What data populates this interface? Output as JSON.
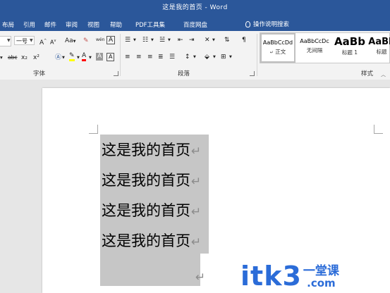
{
  "window": {
    "title": "这是我的首页 - Word"
  },
  "tabs": [
    "布局",
    "引用",
    "邮件",
    "审阅",
    "视图",
    "帮助",
    "PDF工具集",
    "百度网盘"
  ],
  "tell_me": "操作说明搜索",
  "ribbon": {
    "font": {
      "size_value": "一号",
      "grow": "A",
      "shrink": "A",
      "change_case": "Aa",
      "strikethrough": "abc",
      "subscript": "x₂",
      "superscript": "x²",
      "font_color": "A",
      "char_shading": "A",
      "phonetic": "wén",
      "group_label": "字体"
    },
    "paragraph": {
      "group_label": "段落"
    },
    "styles": {
      "group_label": "样式",
      "items": [
        {
          "sample": "AaBbCcDd",
          "name": "正文",
          "selected": true
        },
        {
          "sample": "AaBbCcDc",
          "name": "无间隔",
          "selected": false
        },
        {
          "sample": "AaBb",
          "name": "标题 1",
          "selected": false
        },
        {
          "sample": "AaBk",
          "name": "标题",
          "selected": false
        }
      ]
    }
  },
  "document": {
    "lines": [
      "这是我的首页",
      "这是我的首页",
      "这是我的首页",
      "这是我的首页"
    ],
    "paragraph_mark": "↵"
  },
  "watermark": {
    "main": "itk3",
    "cn": "一堂课",
    "com": ".com"
  },
  "colors": {
    "title_bar": "#2b579a",
    "selection": "#c6c6c6",
    "watermark": "#2b6cd8",
    "highlight_yellow": "#ffff00",
    "font_red": "#ff0000"
  }
}
